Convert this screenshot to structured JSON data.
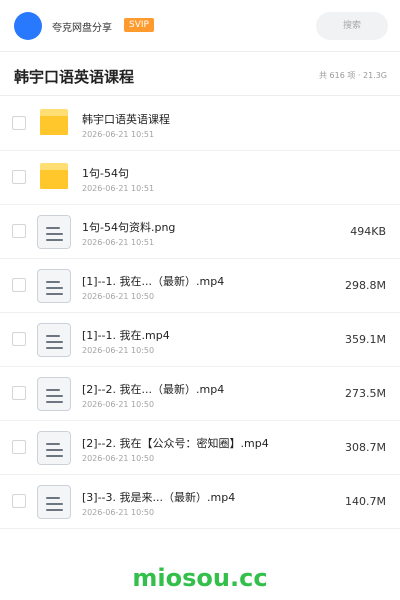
{
  "header": {
    "account_name": "夸克网盘分享",
    "badge": "SVIP",
    "search_placeholder": "搜索",
    "avatar_color": "#2979ff"
  },
  "title_bar": {
    "title": "韩宇口语英语课程",
    "summary": "共 616 项 · 21.3G"
  },
  "files": [
    {
      "type": "folder",
      "icon": "folder-icon",
      "name": "韩宇口语英语课程",
      "date": "2026-06-21 10:51",
      "size": ""
    },
    {
      "type": "folder",
      "icon": "folder-icon",
      "name": "1句-54句",
      "date": "2026-06-21 10:51",
      "size": ""
    },
    {
      "type": "file",
      "icon": "document-icon",
      "name": "1句-54句资料.png",
      "date": "2026-06-21 10:51",
      "size": "494KB"
    },
    {
      "type": "file",
      "icon": "document-icon",
      "name": "[1]--1. 我在...（最新）.mp4",
      "date": "2026-06-21 10:50",
      "size": "298.8M"
    },
    {
      "type": "file",
      "icon": "document-icon",
      "name": "[1]--1. 我在.mp4",
      "date": "2026-06-21 10:50",
      "size": "359.1M"
    },
    {
      "type": "file",
      "icon": "document-icon",
      "name": "[2]--2. 我在...（最新）.mp4",
      "date": "2026-06-21 10:50",
      "size": "273.5M"
    },
    {
      "type": "file",
      "icon": "document-icon",
      "name": "[2]--2. 我在【公众号：密知圈】.mp4",
      "date": "2026-06-21 10:50",
      "size": "308.7M"
    },
    {
      "type": "file",
      "icon": "document-icon",
      "name": "[3]--3. 我是来...（最新）.mp4",
      "date": "2026-06-21 10:50",
      "size": "140.7M"
    }
  ],
  "watermark": "miosou.cc",
  "colors": {
    "badge": "#ff9a2e",
    "folder": "#ffc72c",
    "watermark": "#32c04a"
  }
}
